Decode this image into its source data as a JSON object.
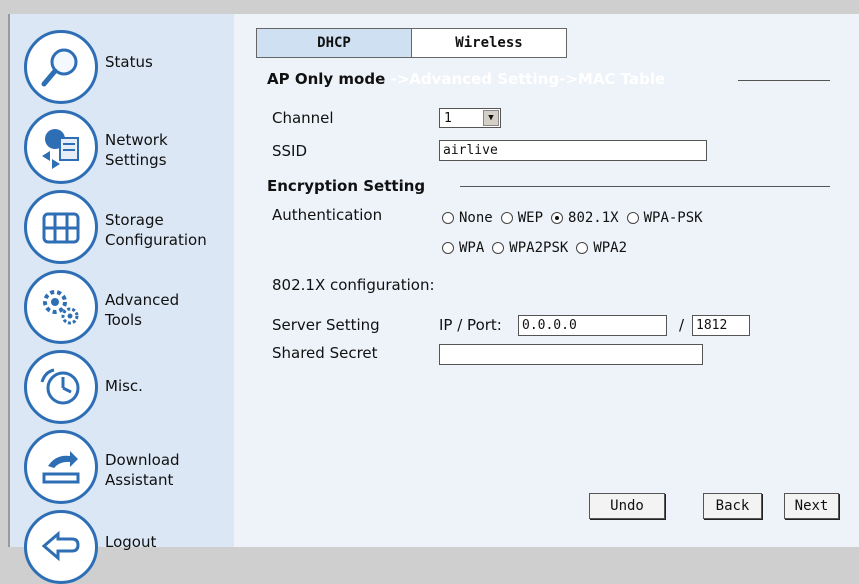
{
  "sidebar": {
    "items": [
      {
        "label": "Status",
        "icon": "magnifier-icon"
      },
      {
        "label": "Network\nSettings",
        "icon": "network-icon"
      },
      {
        "label": "Storage\nConfiguration",
        "icon": "storage-grid-icon"
      },
      {
        "label": "Advanced\nTools",
        "icon": "gears-icon"
      },
      {
        "label": "Misc.",
        "icon": "clock-icon"
      },
      {
        "label": "Download\nAssistant",
        "icon": "download-icon"
      },
      {
        "label": "Logout",
        "icon": "back-arrow-icon"
      }
    ]
  },
  "tabs": [
    {
      "label": "DHCP"
    },
    {
      "label": "Wireless",
      "active": true
    }
  ],
  "ap_section": {
    "title": "AP Only mode",
    "crumb": "->Advanced Setting->MAC Table"
  },
  "channel": {
    "label": "Channel",
    "value": "1"
  },
  "ssid": {
    "label": "SSID",
    "value": "airlive"
  },
  "encryption": {
    "title": "Encryption Setting",
    "auth_label": "Authentication",
    "options_row1": [
      "None",
      "WEP",
      "802.1X",
      "WPA-PSK"
    ],
    "options_row2": [
      "WPA",
      "WPA2PSK",
      "WPA2"
    ],
    "selected": "802.1X"
  },
  "dot1x": {
    "title": "802.1X configuration:",
    "server_label": "Server Setting",
    "ip_port_label": "IP / Port:",
    "ip_value": "0.0.0.0",
    "slash": "/",
    "port_value": "1812",
    "secret_label": "Shared Secret",
    "secret_value": ""
  },
  "buttons": {
    "undo": "Undo",
    "back": "Back",
    "next": "Next"
  },
  "colors": {
    "accent": "#2d6eb5",
    "sidebar_bg": "#dbe7f5",
    "content_bg": "#eef3fa"
  }
}
